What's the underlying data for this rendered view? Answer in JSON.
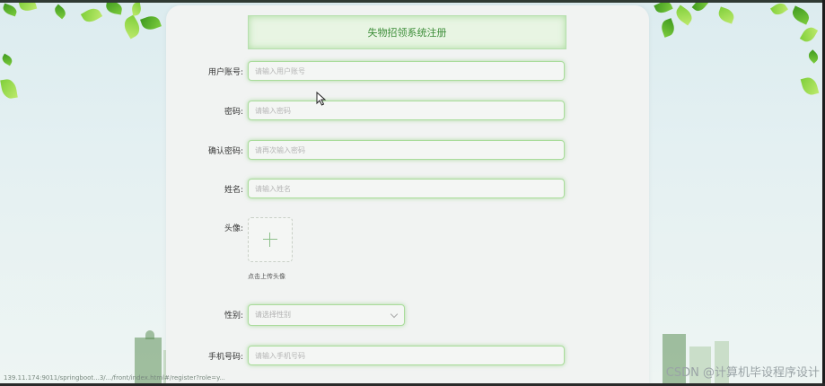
{
  "form": {
    "title": "失物招领系统注册",
    "fields": [
      {
        "label": "用户账号:",
        "placeholder": "请输入用户账号"
      },
      {
        "label": "密码:",
        "placeholder": "请输入密码"
      },
      {
        "label": "确认密码:",
        "placeholder": "请再次输入密码"
      },
      {
        "label": "姓名:",
        "placeholder": "请输入姓名"
      }
    ],
    "avatar": {
      "label": "头像:",
      "hint": "点击上传头像"
    },
    "gender": {
      "label": "性别:",
      "placeholder": "请选择性别"
    },
    "phone": {
      "label": "手机号码:",
      "placeholder": "请输入手机号码"
    }
  },
  "statusbar": {
    "url": "139.11.174:9011/springboot...3/.../front/index.html#/register?role=y..."
  },
  "watermark": "CSDN @计算机毕设程序设计",
  "colors": {
    "accent": "#a9dc9b",
    "title_text": "#3e8e3a"
  },
  "icons": [
    "plus-icon",
    "chevron-down-icon",
    "mouse-cursor-icon"
  ]
}
